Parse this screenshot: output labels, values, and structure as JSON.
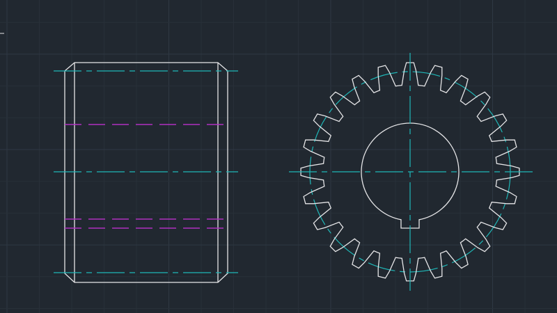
{
  "colors": {
    "background": "#212830",
    "grid_minor": "#283039",
    "grid_major": "#2f3843",
    "outline": "#e6e6e8",
    "centerline": "#1fb8b8",
    "hidden_line": "#b030c0"
  },
  "gear": {
    "tooth_count": 24
  }
}
